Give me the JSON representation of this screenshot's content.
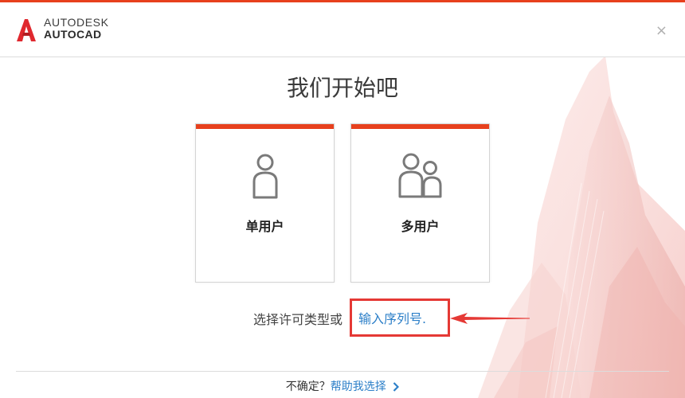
{
  "brand": {
    "line1": "AUTODESK",
    "line2": "AUTOCAD",
    "logo_icon": "autocad-a-logo"
  },
  "window": {
    "close_icon": "close-icon",
    "close_glyph": "×"
  },
  "main": {
    "title": "我们开始吧",
    "cards": [
      {
        "label": "单用户",
        "icon": "single-user-icon"
      },
      {
        "label": "多用户",
        "icon": "multi-user-icon"
      }
    ],
    "hint_text": "选择许可类型或",
    "serial_link": "输入序列号."
  },
  "footer": {
    "question": "不确定？",
    "help_link": "帮助我选择",
    "chevron_icon": "chevron-right-icon"
  },
  "colors": {
    "accent": "#e7401d",
    "link": "#2c7fc8",
    "annotation": "#e53935"
  }
}
